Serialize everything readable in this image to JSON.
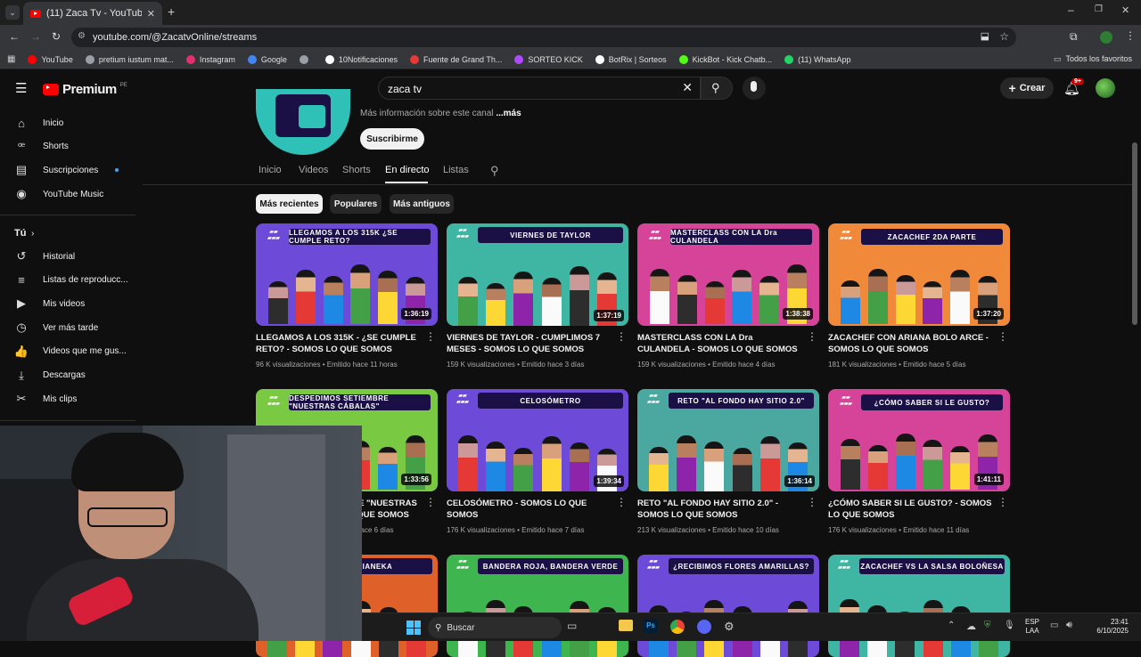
{
  "browser": {
    "tab_title": "(11) Zaca Tv - YouTube",
    "url": "youtube.com/@ZacatvOnline/streams",
    "bookmarks": [
      {
        "label": "YouTube",
        "color": "#ff0000"
      },
      {
        "label": "pretium iustum mat...",
        "color": "#9aa0a6"
      },
      {
        "label": "Instagram",
        "color": "#e1306c"
      },
      {
        "label": "Google",
        "color": "#4285f4"
      },
      {
        "label": "",
        "color": "#9aa0a6"
      },
      {
        "label": "10Notificaciones",
        "color": "#ffffff"
      },
      {
        "label": "Fuente de Grand Th...",
        "color": "#e53935"
      },
      {
        "label": "SORTEO KICK",
        "color": "#b04aff"
      },
      {
        "label": "BotRix | Sorteos",
        "color": "#ffffff"
      },
      {
        "label": "KickBot - Kick Chatb...",
        "color": "#53fc18"
      },
      {
        "label": "(11) WhatsApp",
        "color": "#25d366"
      }
    ],
    "all_bookmarks": "Todos los favoritos"
  },
  "youtube": {
    "logo": "Premium",
    "region": "PE",
    "search_value": "zaca tv",
    "create_label": "Crear",
    "notif_count": "9+"
  },
  "sidebar": {
    "items": [
      {
        "label": "Inicio",
        "icon": "home-icon",
        "glyph": "⌂"
      },
      {
        "label": "Shorts",
        "icon": "shorts-icon",
        "glyph": "ꟹ"
      },
      {
        "label": "Suscripciones",
        "icon": "subscriptions-icon",
        "glyph": "▤"
      },
      {
        "label": "YouTube Music",
        "icon": "music-icon",
        "glyph": "◉"
      }
    ],
    "you_label": "Tú",
    "you_items": [
      {
        "label": "Historial",
        "icon": "history-icon",
        "glyph": "↺"
      },
      {
        "label": "Listas de reproducc...",
        "icon": "playlists-icon",
        "glyph": "≡"
      },
      {
        "label": "Mis videos",
        "icon": "my-videos-icon",
        "glyph": "▶"
      },
      {
        "label": "Ver más tarde",
        "icon": "watch-later-icon",
        "glyph": "◷"
      },
      {
        "label": "Videos que me gus...",
        "icon": "liked-icon",
        "glyph": "👍"
      },
      {
        "label": "Descargas",
        "icon": "downloads-icon",
        "glyph": "⤓"
      },
      {
        "label": "Mis clips",
        "icon": "clips-icon",
        "glyph": "✂"
      }
    ]
  },
  "channel": {
    "more_info": "Más información sobre este canal",
    "more_link": "...más",
    "subscribe": "Suscribirme",
    "tabs": [
      "Inicio",
      "Videos",
      "Shorts",
      "En directo",
      "Listas"
    ],
    "selected_tab": "En directo",
    "chips": [
      "Más recientes",
      "Populares",
      "Más antiguos"
    ],
    "selected_chip": "Más recientes"
  },
  "videos": [
    {
      "title": "LLEGAMOS A LOS 315K - ¿SE CUMPLE RETO? - SOMOS LO QUE SOMOS",
      "meta": "96 K visualizaciones • Emitido hace 11 horas",
      "duration": "1:36:19",
      "band": "LLEGAMOS A LOS 315K ¿SE CUMPLE RETO?",
      "bg": "#6d4bd8"
    },
    {
      "title": "VIERNES DE TAYLOR - CUMPLIMOS 7 MESES - SOMOS LO QUE SOMOS",
      "meta": "159 K visualizaciones • Emitido hace 3 días",
      "duration": "1:37:19",
      "band": "VIERNES DE TAYLOR",
      "bg": "#3fb5a3"
    },
    {
      "title": "MASTERCLASS CON LA Dra CULANDELA - SOMOS LO QUE SOMOS",
      "meta": "159 K visualizaciones • Emitido hace 4 días",
      "duration": "1:38:38",
      "band": "MASTERCLASS CON LA Dra CULANDELA",
      "bg": "#d6449a"
    },
    {
      "title": "ZACACHEF CON ARIANA BOLO ARCE - SOMOS LO QUE SOMOS",
      "meta": "181 K visualizaciones • Emitido hace 5 días",
      "duration": "1:37:20",
      "band": "ZACACHEF 2DA PARTE",
      "bg": "#f08a3a"
    },
    {
      "title": "DESPEDIMOS SETIEMBRE \"NUESTRAS CÁBALAS\" - SOMOS LO QUE SOMOS",
      "meta": "174 K visualizaciones • Emitido hace 6 días",
      "duration": "1:33:56",
      "band": "DESPEDIMOS SETIEMBRE \"NUESTRAS CÁBALAS\"",
      "bg": "#7ac943"
    },
    {
      "title": "CELOSÓMETRO - SOMOS LO QUE SOMOS",
      "meta": "176 K visualizaciones • Emitido hace 7 días",
      "duration": "1:39:34",
      "band": "CELOSÓMETRO",
      "bg": "#6d4bd8"
    },
    {
      "title": "RETO \"AL FONDO HAY SITIO 2.0\" - SOMOS LO QUE SOMOS",
      "meta": "213 K visualizaciones • Emitido hace 10 días",
      "duration": "1:36:14",
      "band": "RETO \"AL FONDO HAY SITIO 2.0\"",
      "bg": "#4aa8a0"
    },
    {
      "title": "¿CÓMO SABER SI LE GUSTO? - SOMOS LO QUE SOMOS",
      "meta": "176 K visualizaciones • Emitido hace 11 días",
      "duration": "1:41:11",
      "band": "¿CÓMO SABER SI LE GUSTO?",
      "bg": "#d6449a"
    },
    {
      "title": "",
      "meta": "",
      "duration": "",
      "band": "CON LUCIANEKA",
      "bg": "#e0602a"
    },
    {
      "title": "",
      "meta": "",
      "duration": "",
      "band": "BANDERA ROJA, BANDERA VERDE",
      "bg": "#3fb54f"
    },
    {
      "title": "",
      "meta": "",
      "duration": "",
      "band": "¿RECIBIMOS FLORES AMARILLAS?",
      "bg": "#6d4bd8"
    },
    {
      "title": "",
      "meta": "",
      "duration": "",
      "band": "ZACACHEF VS LA SALSA BOLOÑESA",
      "bg": "#3fb5a3"
    }
  ],
  "taskbar": {
    "search": "Buscar",
    "lang_top": "ESP",
    "lang_bottom": "LAA",
    "time": "23:41",
    "date": "6/10/2025"
  }
}
